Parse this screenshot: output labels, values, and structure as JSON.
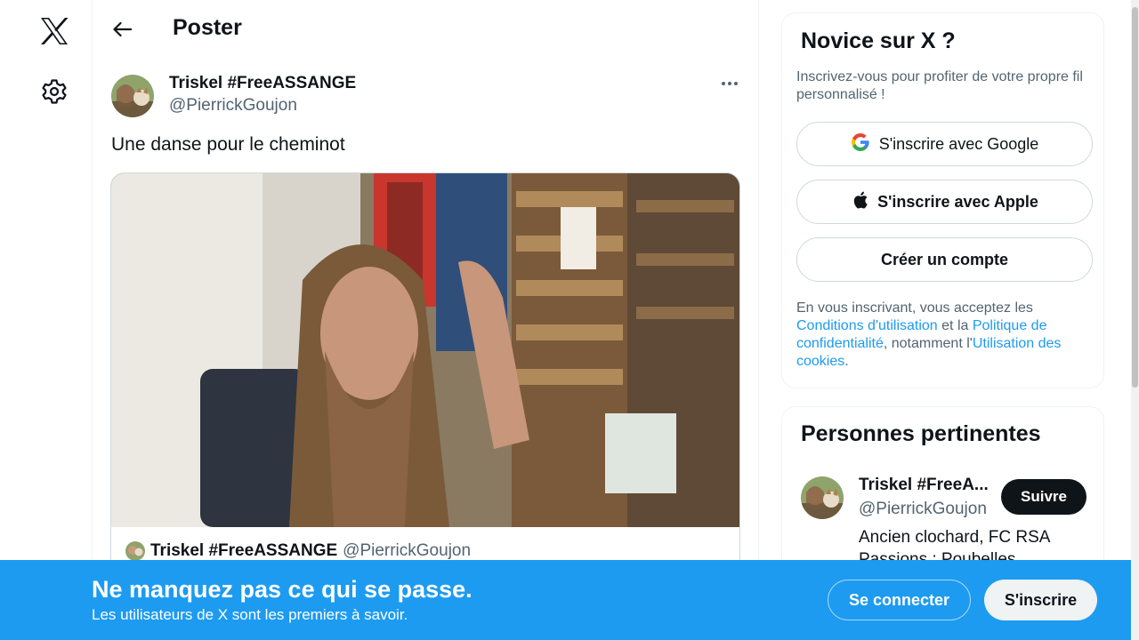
{
  "header": {
    "title": "Poster"
  },
  "tweet": {
    "author_name": "Triskel #FreeASSANGE",
    "author_handle": "@PierrickGoujon",
    "text": "Une danse pour le cheminot",
    "quote": {
      "name": "Triskel #FreeASSANGE",
      "handle": "@PierrickGoujon"
    }
  },
  "signup": {
    "title": "Novice sur X ?",
    "description": "Inscrivez-vous pour profiter de votre propre fil personnalisé !",
    "google_label": "S'inscrire avec Google",
    "apple_label": "S'inscrire avec Apple",
    "create_label": "Créer un compte",
    "legal": {
      "prefix": "En vous inscrivant, vous acceptez les ",
      "terms": "Conditions d'utilisation",
      "and": " et la ",
      "privacy": "Politique de confidentialité",
      "including": ", notamment l'",
      "cookies": "Utilisation des cookies",
      "suffix": "."
    }
  },
  "people": {
    "title": "Personnes pertinentes",
    "person": {
      "name": "Triskel #FreeA...",
      "handle": "@PierrickGoujon",
      "follow_label": "Suivre",
      "bio": "Ancien clochard, FC RSA Passions : Poubelles"
    }
  },
  "banner": {
    "title": "Ne manquez pas ce qui se passe.",
    "subtitle": "Les utilisateurs de X sont les premiers à savoir.",
    "login_label": "Se connecter",
    "signup_label": "S'inscrire"
  },
  "icons": {
    "logo": "x-logo-icon",
    "settings": "gear-icon",
    "back": "arrow-left-icon",
    "more": "more-horizontal-icon",
    "google": "google-icon",
    "apple": "apple-icon"
  },
  "colors": {
    "accent": "#1d9bf0",
    "text": "#0f1419",
    "muted": "#536471"
  }
}
